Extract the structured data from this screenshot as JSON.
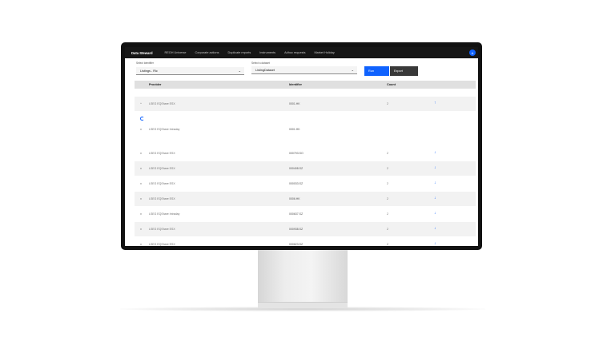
{
  "nav": {
    "brand": "Data Steward",
    "items": [
      "REGH Universe",
      "Corporate actions",
      "Duplicate reports",
      "Instruments",
      "Adhoc requests",
      "Market Holiday"
    ],
    "avatar_initial": "A"
  },
  "filters": {
    "identifier_label": "Select Identifier",
    "identifier_value": "Listings - Ric",
    "dataset_label": "Select a dataset",
    "dataset_value": "ListingDataset"
  },
  "buttons": {
    "run": "Run",
    "export": "Export"
  },
  "table": {
    "headers": {
      "provider": "Provider",
      "identifier": "Identifier",
      "count": "Count"
    },
    "rows": [
      {
        "toggle": "^",
        "provider": "LSEG EQShare ESX",
        "identifier": "0001.HK",
        "count": "2",
        "action": "↑",
        "shade": true
      },
      {
        "toggle": "v",
        "provider": "LSEG EQShare Intraday",
        "identifier": "0001.HK",
        "count": "",
        "action": "",
        "shade": false
      },
      {
        "toggle": "v",
        "provider": "LSEG EQShare ESX",
        "identifier": "000793.SO",
        "count": "2",
        "action": "↓",
        "shade": false
      },
      {
        "toggle": "v",
        "provider": "LSEG EQShare ESX",
        "identifier": "000408.SZ",
        "count": "2",
        "action": "↓",
        "shade": true
      },
      {
        "toggle": "v",
        "provider": "LSEG EQShare ESX",
        "identifier": "000033.SZ",
        "count": "2",
        "action": "↓",
        "shade": false
      },
      {
        "toggle": "v",
        "provider": "LSEG EQShare ESX",
        "identifier": "0006.HK",
        "count": "2",
        "action": "↓",
        "shade": true
      },
      {
        "toggle": "v",
        "provider": "LSEG EQShare Intraday",
        "identifier": "000637.SZ",
        "count": "2",
        "action": "↓",
        "shade": false
      },
      {
        "toggle": "v",
        "provider": "LSEG EQShare ESX",
        "identifier": "000938.SZ",
        "count": "2",
        "action": "↓",
        "shade": true
      },
      {
        "toggle": "v",
        "provider": "LSEG EQShare ESX",
        "identifier": "000623.SZ",
        "count": "2",
        "action": "↓",
        "shade": false
      }
    ]
  },
  "colors": {
    "accent": "#0f62fe",
    "nav_bg": "#161616"
  }
}
